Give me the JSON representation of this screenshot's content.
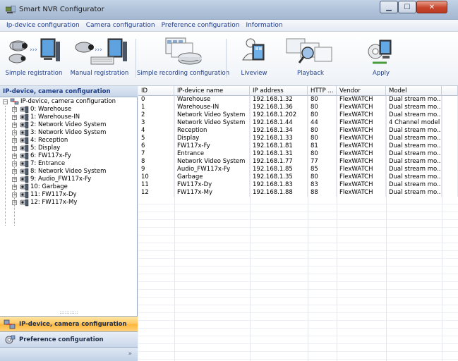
{
  "window": {
    "title": "Smart NVR Configurator"
  },
  "menu": [
    "Ip-device configuration",
    "Camera configuration",
    "Preference configuration",
    "Information"
  ],
  "toolbar": [
    {
      "label": "Simple registration",
      "icon": "camera-to-monitor-icon"
    },
    {
      "label": "Manual registration",
      "icon": "camera-keyboard-monitor-icon"
    },
    {
      "label": "Simple recording configuration",
      "icon": "recording-disk-icon"
    },
    {
      "label": "Liveview",
      "icon": "liveview-person-icon"
    },
    {
      "label": "Playback",
      "icon": "playback-search-icon"
    },
    {
      "label": "Apply",
      "icon": "apply-network-icon"
    }
  ],
  "left_panel": {
    "header": "IP-device, camera configuration",
    "tree": {
      "root": "IP-device, camera configuration",
      "items": [
        "0: Warehouse",
        "1: Warehouse-IN",
        "2: Network Video System",
        "3: Network Video System",
        "4: Reception",
        "5: Display",
        "6: FW117x-Fy",
        "7: Entrance",
        "8: Network Video System",
        "9: Audio_FW117x-Fy",
        "10: Garbage",
        "11: FW117x-Dy",
        "12: FW117x-My"
      ]
    },
    "nav": {
      "active": "IP-device, camera configuration",
      "inactive": "Preference configuration",
      "more": "»"
    }
  },
  "grid": {
    "columns": [
      "ID",
      "IP-device name",
      "IP address",
      "HTTP ...",
      "Vendor",
      "Model"
    ],
    "rows": [
      [
        "0",
        "Warehouse",
        "192.168.1.32",
        "80",
        "FlexWATCH",
        "Dual stream mo..."
      ],
      [
        "1",
        "Warehouse-IN",
        "192.168.1.36",
        "80",
        "FlexWATCH",
        "Dual stream mo..."
      ],
      [
        "2",
        "Network Video System",
        "192.168.1.202",
        "80",
        "FlexWATCH",
        "Dual stream mo..."
      ],
      [
        "3",
        "Network Video System",
        "192.168.1.44",
        "44",
        "FlexWATCH",
        "4 Channel model"
      ],
      [
        "4",
        "Reception",
        "192.168.1.34",
        "80",
        "FlexWATCH",
        "Dual stream mo..."
      ],
      [
        "5",
        "Display",
        "192.168.1.33",
        "80",
        "FlexWATCH",
        "Dual stream mo..."
      ],
      [
        "6",
        "FW117x-Fy",
        "192.168.1.81",
        "81",
        "FlexWATCH",
        "Dual stream mo..."
      ],
      [
        "7",
        "Entrance",
        "192.168.1.31",
        "80",
        "FlexWATCH",
        "Dual stream mo..."
      ],
      [
        "8",
        "Network Video System",
        "192.168.1.77",
        "77",
        "FlexWATCH",
        "Dual stream mo..."
      ],
      [
        "9",
        "Audio_FW117x-Fy",
        "192.168.1.85",
        "85",
        "FlexWATCH",
        "Dual stream mo..."
      ],
      [
        "10",
        "Garbage",
        "192.168.1.35",
        "80",
        "FlexWATCH",
        "Dual stream mo..."
      ],
      [
        "11",
        "FW117x-Dy",
        "192.168.1.83",
        "83",
        "FlexWATCH",
        "Dual stream mo..."
      ],
      [
        "12",
        "FW117x-My",
        "192.168.1.88",
        "88",
        "FlexWATCH",
        "Dual stream mo..."
      ]
    ]
  },
  "colors": {
    "accent": "#1d3d8a",
    "active_nav": "#ffc660",
    "header": "#c7d5e8"
  }
}
